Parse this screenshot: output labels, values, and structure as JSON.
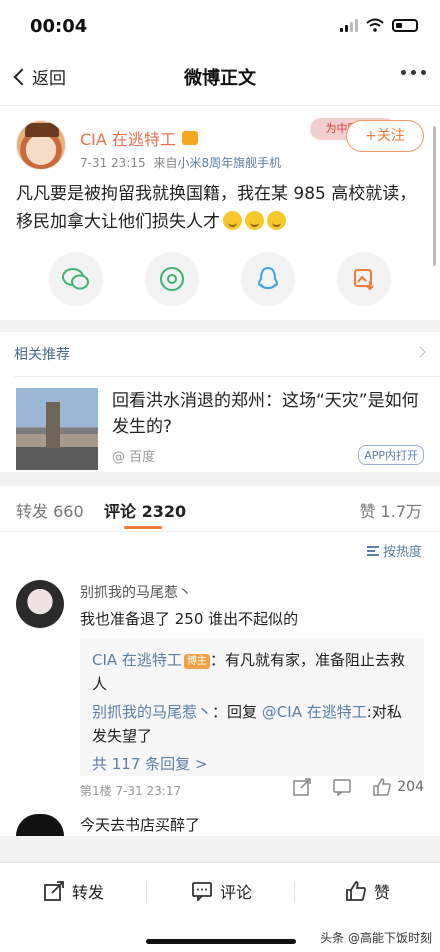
{
  "status_bar": {
    "time": "00:04"
  },
  "nav": {
    "back_label": "返回",
    "title": "微博正文"
  },
  "post": {
    "author": "CIA 在逃特工",
    "date": "7-31 23:15",
    "source_prefix": "来自",
    "source": "小米8周年旗舰手机",
    "badge": "为中国加油",
    "follow_label": "+关注",
    "text": "凡凡要是被拘留我就换国籍，我在某 985 高校就读，移民加拿大让他们损失人才"
  },
  "recommend": {
    "title": "相关推荐",
    "headline": "回看洪水消退的郑州：这场“天灾”是如何发生的?",
    "source": "@ 百度",
    "app_label": "APP内打开"
  },
  "tabs": {
    "repost_label": "转发",
    "repost_count": "660",
    "comment_label": "评论",
    "comment_count": "2320",
    "like_label": "赞",
    "like_count": "1.7万"
  },
  "sort": {
    "label": "按热度"
  },
  "comments": [
    {
      "name": "别抓我的马尾惹丶",
      "text": "我也准备退了 250 谁出不起似的",
      "replies": [
        {
          "name": "CIA 在逃特工",
          "tag": "博主",
          "text": "：有凡就有家，准备阻止去救人"
        },
        {
          "name": "别抓我的马尾惹丶",
          "mid": "：回复 ",
          "mention": "@CIA 在逃特工",
          "text": ":对私发失望了"
        }
      ],
      "more_replies": "共 117 条回复 >",
      "floor": "第1楼",
      "date": "7-31 23:17",
      "likes": "204"
    },
    {
      "text": "今天去书店买醉了"
    }
  ],
  "bottom_bar": {
    "repost": "转发",
    "comment": "评论",
    "like": "赞"
  },
  "watermark": "头条 @高能下饭时刻"
}
